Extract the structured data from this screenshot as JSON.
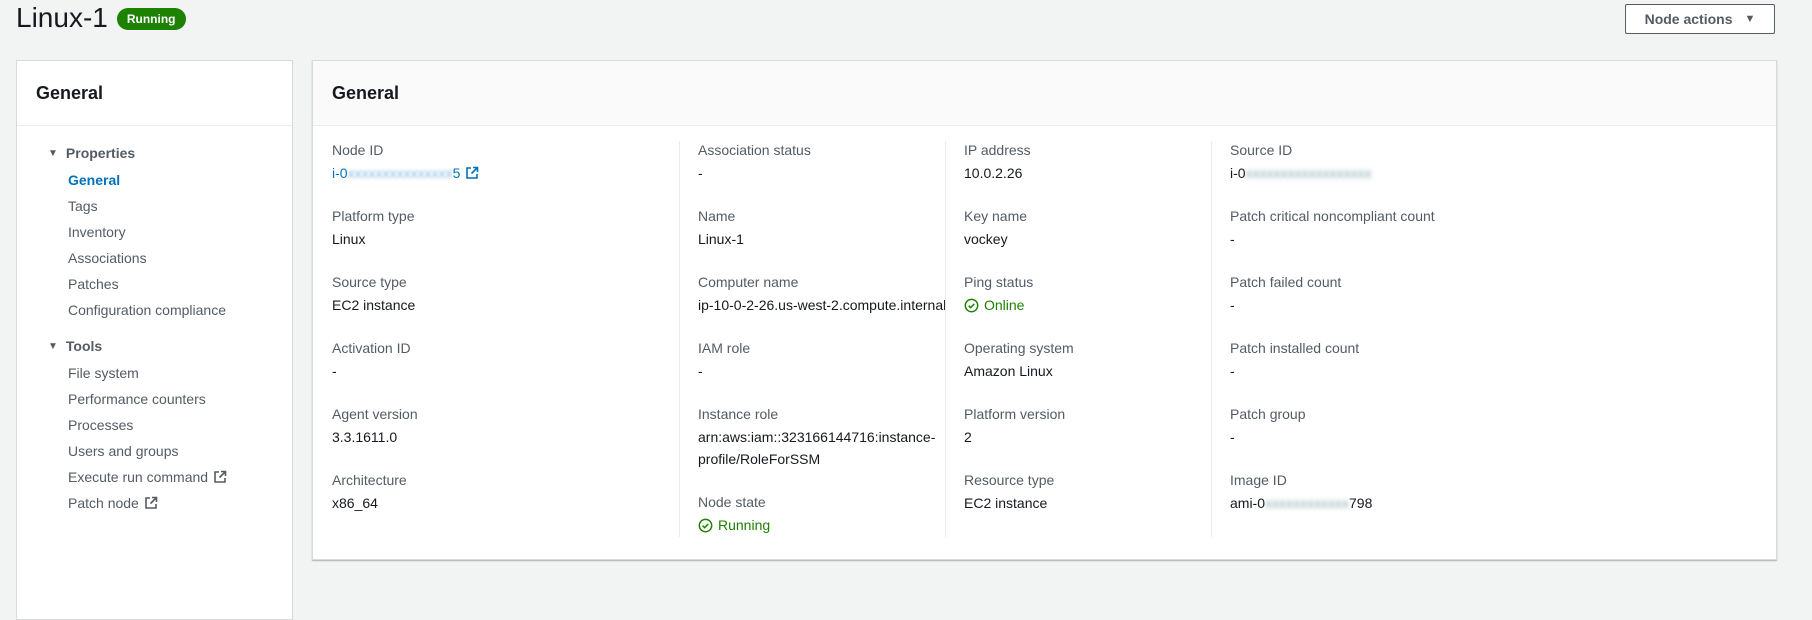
{
  "page": {
    "title": "Linux-1",
    "status_badge": "Running",
    "node_actions_label": "Node actions"
  },
  "sidebar": {
    "title": "General",
    "groups": [
      {
        "label": "Properties",
        "items": [
          "General",
          "Tags",
          "Inventory",
          "Associations",
          "Patches",
          "Configuration compliance"
        ]
      },
      {
        "label": "Tools",
        "items": [
          "File system",
          "Performance counters",
          "Processes",
          "Users and groups",
          "Execute run command",
          "Patch node"
        ]
      }
    ],
    "active_item": "General"
  },
  "main": {
    "title": "General",
    "columns": [
      [
        {
          "label": "Node ID",
          "value_start": "i-0",
          "value_end": "5"
        },
        {
          "label": "Platform type",
          "value": "Linux"
        },
        {
          "label": "Source type",
          "value": "EC2 instance"
        },
        {
          "label": "Activation ID",
          "value": "-"
        },
        {
          "label": "Agent version",
          "value": "3.3.1611.0"
        },
        {
          "label": "Architecture",
          "value": "x86_64"
        }
      ],
      [
        {
          "label": "Association status",
          "value": "-"
        },
        {
          "label": "Name",
          "value": "Linux-1"
        },
        {
          "label": "Computer name",
          "value": "ip-10-0-2-26.us-west-2.compute.internal"
        },
        {
          "label": "IAM role",
          "value": "-"
        },
        {
          "label": "Instance role",
          "value_line1": "arn:aws:iam::323166144716:instance-",
          "value_line2": "profile/RoleForSSM"
        },
        {
          "label": "Node state",
          "value": "Running"
        }
      ],
      [
        {
          "label": "IP address",
          "value": "10.0.2.26"
        },
        {
          "label": "Key name",
          "value": "vockey"
        },
        {
          "label": "Ping status",
          "value": "Online"
        },
        {
          "label": "Operating system",
          "value": "Amazon Linux"
        },
        {
          "label": "Platform version",
          "value": "2"
        },
        {
          "label": "Resource type",
          "value": "EC2 instance"
        }
      ],
      [
        {
          "label": "Source ID",
          "value_start": "i-0"
        },
        {
          "label": "Patch critical noncompliant count",
          "value": "-"
        },
        {
          "label": "Patch failed count",
          "value": "-"
        },
        {
          "label": "Patch installed count",
          "value": "-"
        },
        {
          "label": "Patch group",
          "value": "-"
        },
        {
          "label": "Image ID",
          "value_start": "ami-0",
          "value_end": "798"
        }
      ]
    ]
  },
  "colors": {
    "accent_link": "#0073bb",
    "status_green": "#1d8102",
    "background": "#f2f3f3"
  },
  "icons": [
    "external-link-icon",
    "check-circle-icon",
    "caret-down-icon",
    "triangle-down-icon"
  ]
}
